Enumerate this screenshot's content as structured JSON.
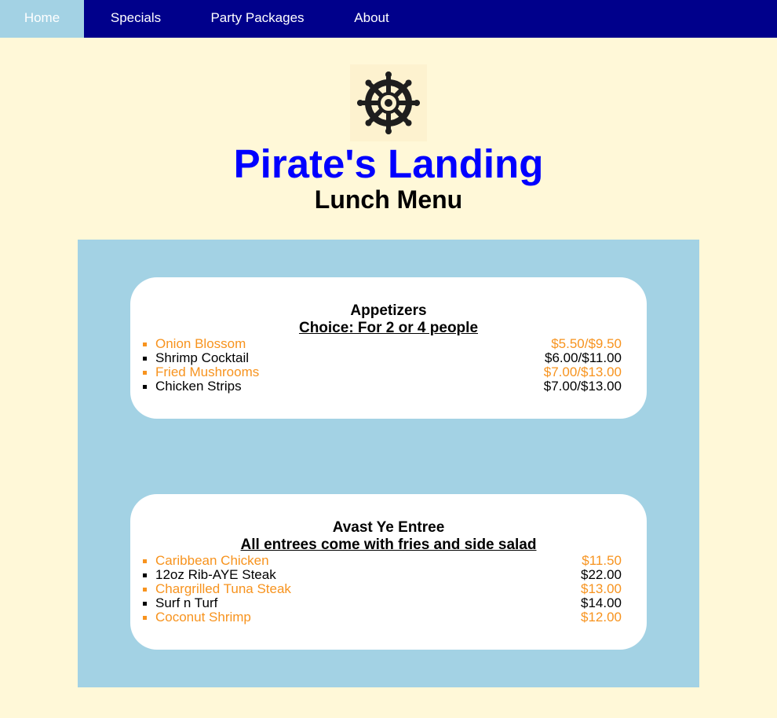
{
  "nav": {
    "items": [
      {
        "label": "Home",
        "active": true
      },
      {
        "label": "Specials",
        "active": false
      },
      {
        "label": "Party Packages",
        "active": false
      },
      {
        "label": "About",
        "active": false
      }
    ]
  },
  "header": {
    "logo_icon": "ship-wheel-icon",
    "title": "Pirate's Landing",
    "subtitle": "Lunch Menu"
  },
  "colors": {
    "nav_bg": "#00008b",
    "nav_active": "#a3d2e4",
    "page_bg": "#fff8d8",
    "title": "#0000ff",
    "accent": "#f7931e",
    "panel_bg": "#a3d2e4"
  },
  "sections": [
    {
      "title": "Appetizers",
      "subtitle": "Choice: For 2 or 4 people",
      "items": [
        {
          "name": "Onion Blossom",
          "price": "$5.50/$9.50"
        },
        {
          "name": "Shrimp Cocktail",
          "price": "$6.00/$11.00"
        },
        {
          "name": "Fried Mushrooms",
          "price": "$7.00/$13.00"
        },
        {
          "name": "Chicken Strips",
          "price": "$7.00/$13.00"
        }
      ]
    },
    {
      "title": "Avast Ye Entree",
      "subtitle": "All entrees come with fries and side salad",
      "items": [
        {
          "name": "Caribbean Chicken",
          "price": "$11.50"
        },
        {
          "name": "12oz Rib-AYE Steak",
          "price": "$22.00"
        },
        {
          "name": "Chargrilled Tuna Steak",
          "price": "$13.00"
        },
        {
          "name": "Surf n Turf",
          "price": "$14.00"
        },
        {
          "name": "Coconut Shrimp",
          "price": "$12.00"
        }
      ]
    }
  ]
}
